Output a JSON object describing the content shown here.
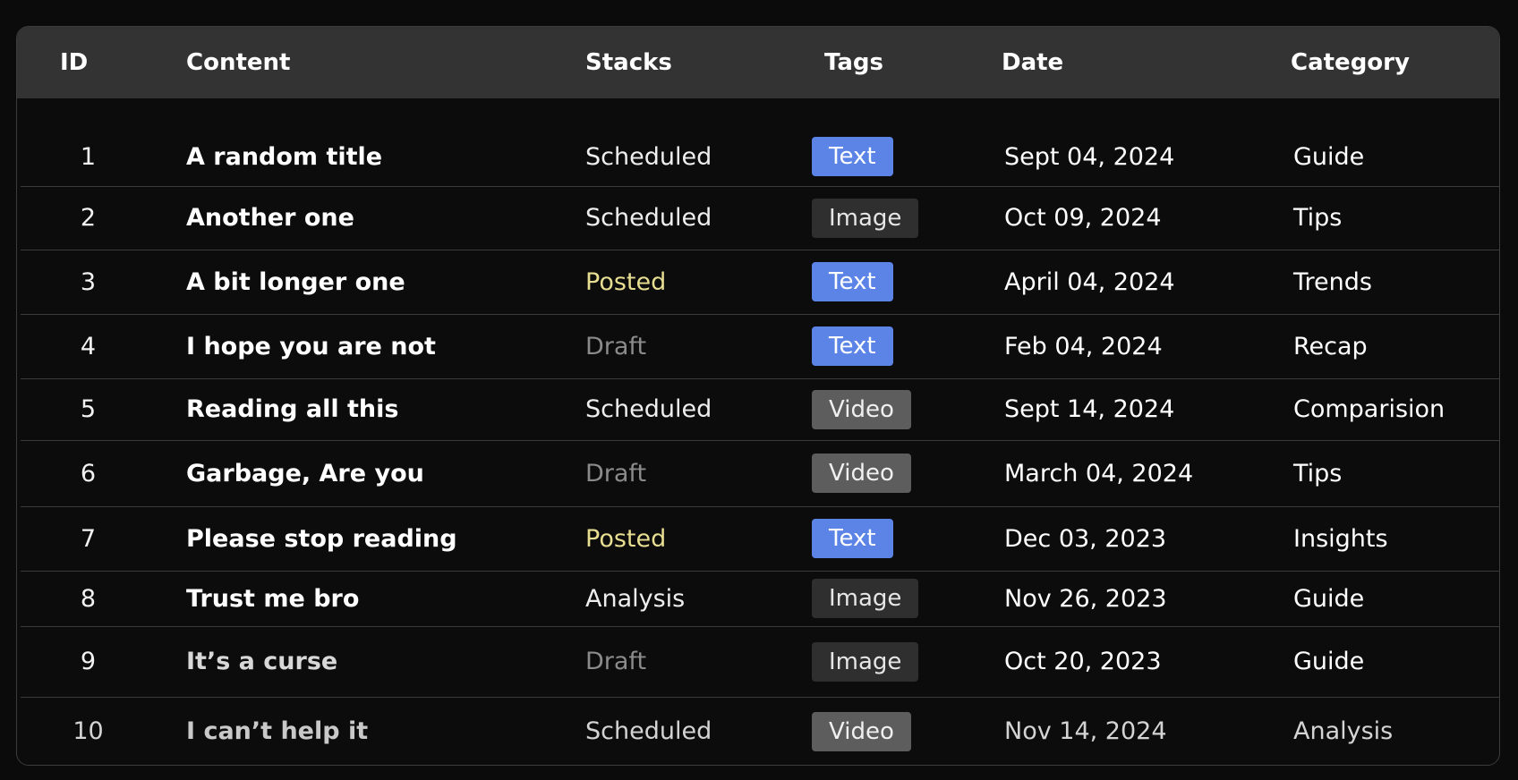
{
  "columns": {
    "id": "ID",
    "content": "Content",
    "stacks": "Stacks",
    "tags": "Tags",
    "date": "Date",
    "category": "Category"
  },
  "tag_colors": {
    "Text": "#5b84e6",
    "Image": "#2f2f2f",
    "Video": "#5d5d5d"
  },
  "stack_colors": {
    "Scheduled": "#eeeeee",
    "Posted": "#e8de92",
    "Draft": "#8b8b8b",
    "Analysis": "#eeeeee"
  },
  "rows": [
    {
      "id": "1",
      "content": "A random title",
      "stack": "Scheduled",
      "tag": "Text",
      "date": "Sept 04, 2024",
      "category": "Guide"
    },
    {
      "id": "2",
      "content": "Another one",
      "stack": "Scheduled",
      "tag": "Image",
      "date": "Oct 09, 2024",
      "category": "Tips"
    },
    {
      "id": "3",
      "content": "A bit longer one",
      "stack": "Posted",
      "tag": "Text",
      "date": "April 04, 2024",
      "category": "Trends"
    },
    {
      "id": "4",
      "content": "I hope you are not",
      "stack": "Draft",
      "tag": "Text",
      "date": "Feb 04, 2024",
      "category": "Recap"
    },
    {
      "id": "5",
      "content": "Reading all this",
      "stack": "Scheduled",
      "tag": "Video",
      "date": "Sept 14, 2024",
      "category": "Comparision"
    },
    {
      "id": "6",
      "content": "Garbage, Are you",
      "stack": "Draft",
      "tag": "Video",
      "date": "March 04, 2024",
      "category": "Tips"
    },
    {
      "id": "7",
      "content": "Please stop reading",
      "stack": "Posted",
      "tag": "Text",
      "date": "Dec 03, 2023",
      "category": "Insights"
    },
    {
      "id": "8",
      "content": "Trust me bro",
      "stack": "Analysis",
      "tag": "Image",
      "date": "Nov 26, 2023",
      "category": "Guide"
    },
    {
      "id": "9",
      "content": "It’s a curse",
      "stack": "Draft",
      "tag": "Image",
      "date": "Oct 20, 2023",
      "category": "Guide"
    },
    {
      "id": "10",
      "content": "I can’t help it",
      "stack": "Scheduled",
      "tag": "Video",
      "date": "Nov 14, 2024",
      "category": "Analysis"
    }
  ]
}
